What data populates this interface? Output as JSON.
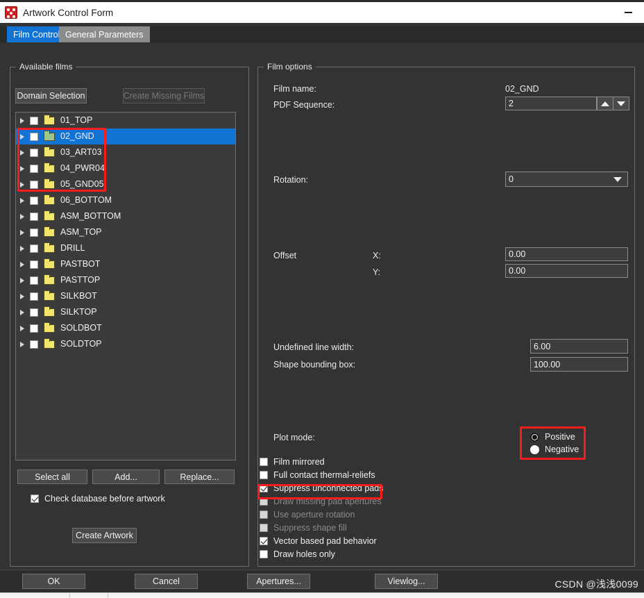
{
  "window": {
    "title": "Artwork Control Form",
    "icon": "app-dice-icon",
    "minimize_label": "Minimize"
  },
  "tabs": [
    {
      "label": "Film Control",
      "active": true
    },
    {
      "label": "General Parameters",
      "active": false
    }
  ],
  "available_films": {
    "group_title": "Available films",
    "buttons": {
      "domain_selection": "Domain Selection",
      "create_missing_films": "Create Missing Films",
      "select_all": "Select all",
      "add": "Add...",
      "replace": "Replace...",
      "create_artwork": "Create Artwork"
    },
    "check_database": {
      "label": "Check database before artwork",
      "checked": true
    },
    "items": [
      {
        "label": "01_TOP",
        "checked": false,
        "selected": false,
        "folder_color": "yellow"
      },
      {
        "label": "02_GND",
        "checked": false,
        "selected": true,
        "folder_color": "green"
      },
      {
        "label": "03_ART03",
        "checked": false,
        "selected": false,
        "folder_color": "yellow"
      },
      {
        "label": "04_PWR04",
        "checked": false,
        "selected": false,
        "folder_color": "yellow"
      },
      {
        "label": "05_GND05",
        "checked": false,
        "selected": false,
        "folder_color": "yellow"
      },
      {
        "label": "06_BOTTOM",
        "checked": false,
        "selected": false,
        "folder_color": "yellow"
      },
      {
        "label": "ASM_BOTTOM",
        "checked": false,
        "selected": false,
        "folder_color": "yellow"
      },
      {
        "label": "ASM_TOP",
        "checked": false,
        "selected": false,
        "folder_color": "yellow"
      },
      {
        "label": "DRILL",
        "checked": false,
        "selected": false,
        "folder_color": "yellow"
      },
      {
        "label": "PASTBOT",
        "checked": false,
        "selected": false,
        "folder_color": "yellow"
      },
      {
        "label": "PASTTOP",
        "checked": false,
        "selected": false,
        "folder_color": "yellow"
      },
      {
        "label": "SILKBOT",
        "checked": false,
        "selected": false,
        "folder_color": "yellow"
      },
      {
        "label": "SILKTOP",
        "checked": false,
        "selected": false,
        "folder_color": "yellow"
      },
      {
        "label": "SOLDBOT",
        "checked": false,
        "selected": false,
        "folder_color": "yellow"
      },
      {
        "label": "SOLDTOP",
        "checked": false,
        "selected": false,
        "folder_color": "yellow"
      }
    ]
  },
  "film_options": {
    "group_title": "Film options",
    "film_name_label": "Film name:",
    "film_name_value": "02_GND",
    "pdf_sequence_label": "PDF Sequence:",
    "pdf_sequence_value": "2",
    "rotation_label": "Rotation:",
    "rotation_value": "0",
    "offset_label": "Offset",
    "offset_x_label": "X:",
    "offset_x_value": "0.00",
    "offset_y_label": "Y:",
    "offset_y_value": "0.00",
    "undefined_line_width_label": "Undefined line width:",
    "undefined_line_width_value": "6.00",
    "shape_bounding_box_label": "Shape bounding box:",
    "shape_bounding_box_value": "100.00",
    "plot_mode_label": "Plot mode:",
    "plot_mode_options": [
      {
        "label": "Positive",
        "selected": true
      },
      {
        "label": "Negative",
        "selected": false
      }
    ],
    "checkboxes": [
      {
        "label": "Film mirrored",
        "checked": false,
        "disabled": false
      },
      {
        "label": "Full contact thermal-reliefs",
        "checked": false,
        "disabled": false
      },
      {
        "label": "Suppress unconnected pads",
        "checked": true,
        "disabled": false
      },
      {
        "label": "Draw missing pad apertures",
        "checked": false,
        "disabled": true
      },
      {
        "label": "Use aperture rotation",
        "checked": false,
        "disabled": true
      },
      {
        "label": "Suppress shape fill",
        "checked": false,
        "disabled": true
      },
      {
        "label": "Vector based pad behavior",
        "checked": true,
        "disabled": false
      },
      {
        "label": "Draw holes only",
        "checked": false,
        "disabled": false
      }
    ]
  },
  "footer": {
    "ok": "OK",
    "cancel": "Cancel",
    "apertures": "Apertures...",
    "viewlog": "Viewlog..."
  },
  "watermark": "CSDN @浅浅0099",
  "colors": {
    "accent_blue": "#1273d5",
    "annotation_red": "#fd1c1c",
    "window_bg": "#333333",
    "titlebar_bg": "#ffffff"
  }
}
